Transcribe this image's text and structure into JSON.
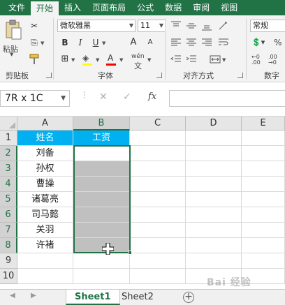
{
  "ribbon_tabs": [
    "文件",
    "开始",
    "插入",
    "页面布局",
    "公式",
    "数据",
    "审阅",
    "视图"
  ],
  "ribbon": {
    "clipboard_label": "剪贴板",
    "paste_label": "粘贴",
    "font_label": "字体",
    "font_name": "微软雅黑",
    "font_size": "11",
    "bold": "B",
    "italic": "I",
    "underline": "U",
    "grow_font": "A",
    "shrink_font": "A",
    "font_color": "A",
    "phonetic": "wén",
    "alignment_label": "对齐方式",
    "number_label": "数字",
    "number_format": "常规"
  },
  "formula_bar": {
    "name_box": "7R x 1C",
    "cancel": "✕",
    "enter": "✓",
    "fx": "fx",
    "value": ""
  },
  "grid": {
    "columns": [
      "A",
      "B",
      "C",
      "D",
      "E"
    ],
    "rows": [
      "1",
      "2",
      "3",
      "4",
      "5",
      "6",
      "7",
      "8",
      "9",
      "10"
    ],
    "cells": {
      "A1": "姓名",
      "B1": "工资",
      "A2": "刘备",
      "A3": "孙权",
      "A4": "曹操",
      "A5": "诸葛亮",
      "A6": "司马懿",
      "A7": "关羽",
      "A8": "许褚"
    },
    "header_fill": "#00b0f0",
    "selection_fill": "#c0c0c0",
    "selection_border": "#217346"
  },
  "sheets": [
    "Sheet1",
    "Sheet2"
  ],
  "active_sheet": "Sheet1",
  "watermark": "Bai 经验"
}
